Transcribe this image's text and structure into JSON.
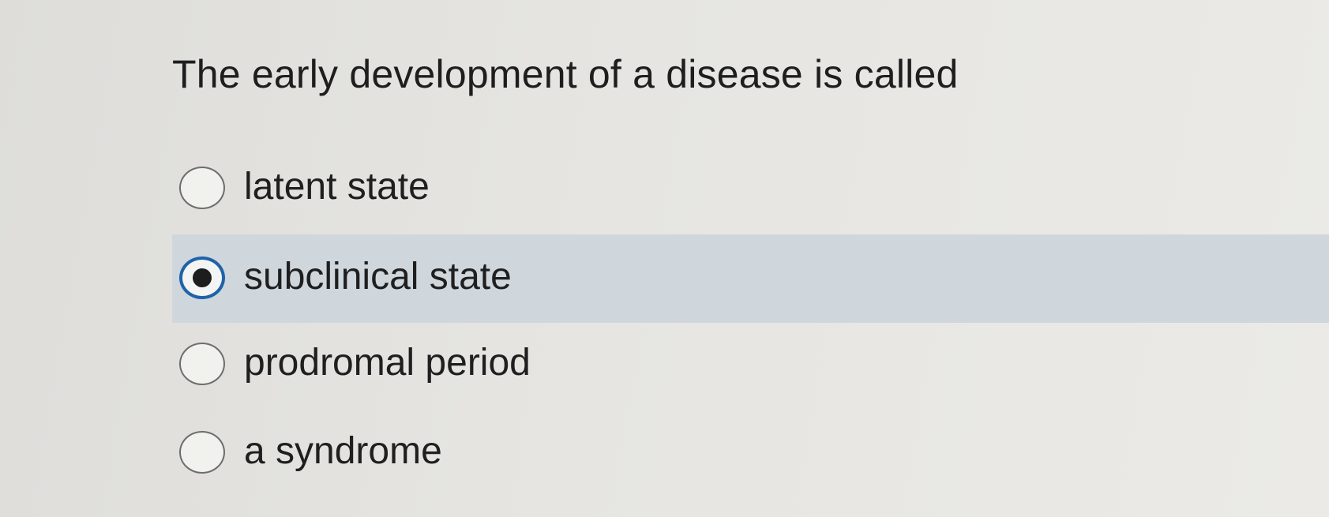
{
  "question": {
    "text": "The early development of a disease is called"
  },
  "options": [
    {
      "label": "latent state",
      "selected": false
    },
    {
      "label": "subclinical state",
      "selected": true
    },
    {
      "label": "prodromal period",
      "selected": false
    },
    {
      "label": "a syndrome",
      "selected": false
    }
  ],
  "colors": {
    "selected_row_background": "#cfd7dd",
    "selected_radio_border": "#1f62a7",
    "page_background": "#e3e2de"
  }
}
